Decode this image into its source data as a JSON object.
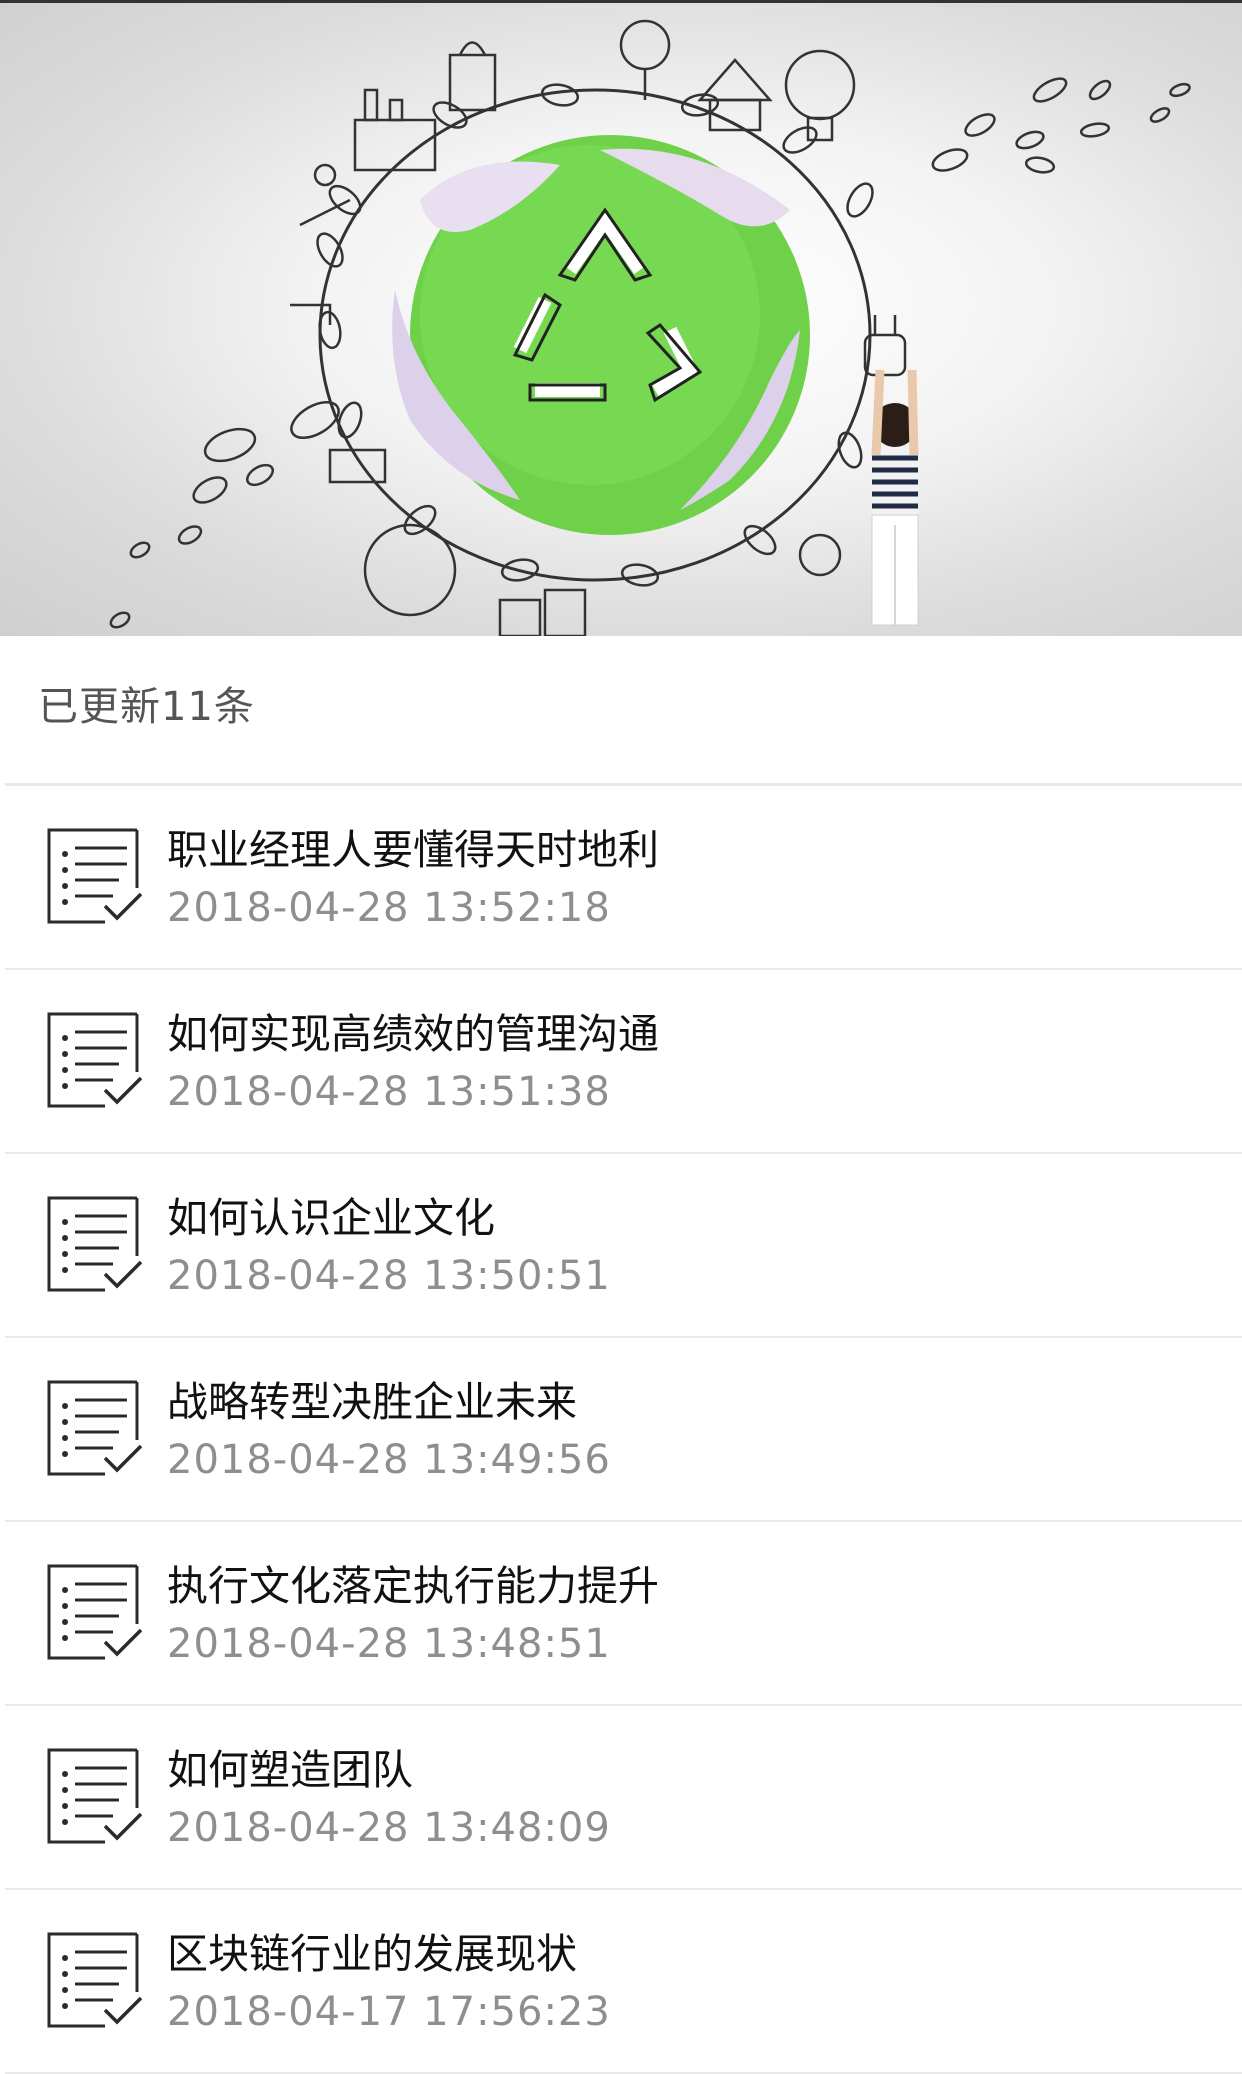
{
  "banner": {
    "image": "recycling-globe-illustration"
  },
  "header": {
    "update_count": "已更新11条"
  },
  "list": {
    "icon": "checklist-icon",
    "items": [
      {
        "title": "职业经理人要懂得天时地利",
        "date": "2018-04-28 13:52:18"
      },
      {
        "title": "如何实现高绩效的管理沟通",
        "date": "2018-04-28 13:51:38"
      },
      {
        "title": "如何认识企业文化",
        "date": "2018-04-28 13:50:51"
      },
      {
        "title": "战略转型决胜企业未来",
        "date": "2018-04-28 13:49:56"
      },
      {
        "title": "执行文化落定执行能力提升",
        "date": "2018-04-28 13:48:51"
      },
      {
        "title": "如何塑造团队",
        "date": "2018-04-28 13:48:09"
      },
      {
        "title": "区块链行业的发展现状",
        "date": "2018-04-17 17:56:23"
      }
    ]
  },
  "colors": {
    "globe_green": "#6fd14a",
    "divider": "#e9e9e9",
    "date_gray": "#8e8e8e"
  }
}
